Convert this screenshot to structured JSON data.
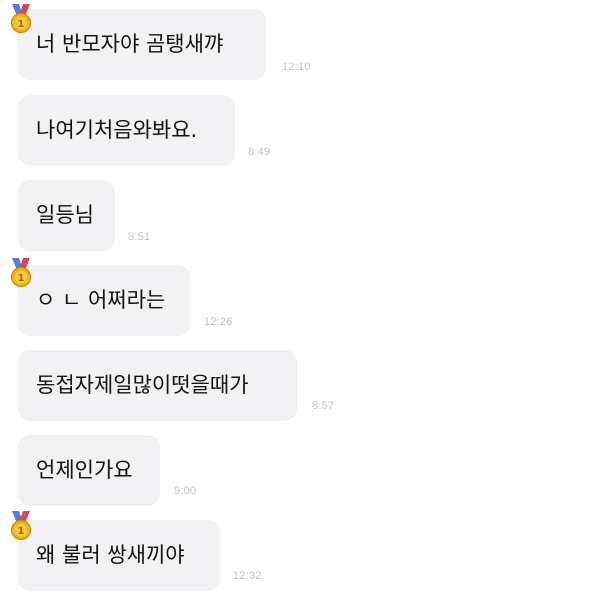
{
  "messages": [
    {
      "text": "너 반모자야 곰탱새꺄",
      "time": "12:10",
      "has_medal": true
    },
    {
      "text": "나여기처음와봐요.",
      "time": "8:49",
      "has_medal": false
    },
    {
      "text": "일등님",
      "time": "8:51",
      "has_medal": false
    },
    {
      "text": "ㅇ ㄴ 어쩌라는",
      "time": "12:26",
      "has_medal": true
    },
    {
      "text": "동접자제일많이떳을때가",
      "time": "8:57",
      "has_medal": false
    },
    {
      "text": "언제인가요",
      "time": "9:00",
      "has_medal": false
    },
    {
      "text": "왜 불러 쌍새끼야",
      "time": "12:32",
      "has_medal": true
    }
  ],
  "medal_icon": "gold-medal-first-place-icon",
  "colors": {
    "bubble": "#f2f2f4",
    "text": "#111111",
    "time": "#c3c3c8",
    "medal_gold": "#f2b21c",
    "ribbon_left": "#5b7ad6",
    "ribbon_right": "#d14b5b"
  }
}
